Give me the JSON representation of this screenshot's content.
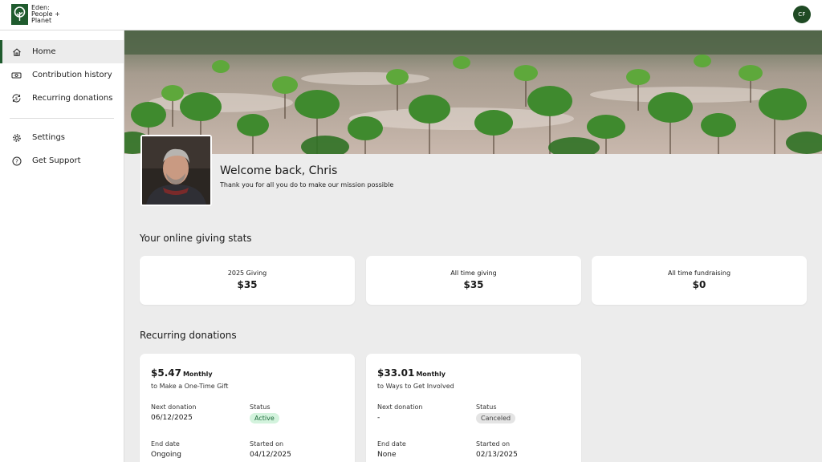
{
  "brand": {
    "name_line1": "Eden:",
    "name_line2": "People +",
    "name_line3": "Planet",
    "color": "#1f5b2e"
  },
  "user": {
    "initials": "CF"
  },
  "sidebar": {
    "items": [
      {
        "label": "Home",
        "icon": "home-icon",
        "active": true
      },
      {
        "label": "Contribution history",
        "icon": "cash-icon",
        "active": false
      },
      {
        "label": "Recurring donations",
        "icon": "recurring-dollar-icon",
        "active": false
      }
    ],
    "secondary": [
      {
        "label": "Settings",
        "icon": "gear-icon"
      },
      {
        "label": "Get Support",
        "icon": "help-circle-icon"
      }
    ]
  },
  "welcome": {
    "title": "Welcome back, Chris",
    "subtitle": "Thank you for all you do to make our mission possible"
  },
  "stats": {
    "title": "Your online giving stats",
    "cards": [
      {
        "label": "2025 Giving",
        "value": "$35"
      },
      {
        "label": "All time giving",
        "value": "$35"
      },
      {
        "label": "All time fundraising",
        "value": "$0"
      }
    ]
  },
  "recurring": {
    "title": "Recurring donations",
    "field_labels": {
      "next": "Next donation",
      "status": "Status",
      "end": "End date",
      "started": "Started on"
    },
    "cards": [
      {
        "amount": "$5.47",
        "frequency": "Monthly",
        "to": "to Make a One-Time Gift",
        "next_donation": "06/12/2025",
        "status": "Active",
        "end_date": "Ongoing",
        "started_on": "04/12/2025"
      },
      {
        "amount": "$33.01",
        "frequency": "Monthly",
        "to": "to Ways to Get Involved",
        "next_donation": "-",
        "status": "Canceled",
        "end_date": "None",
        "started_on": "02/13/2025"
      }
    ]
  }
}
